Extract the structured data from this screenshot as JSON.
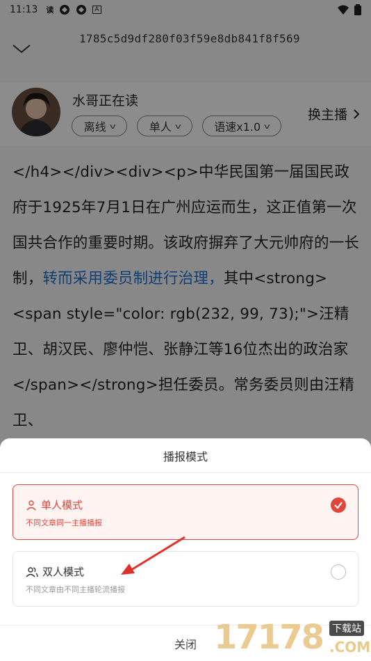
{
  "status": {
    "time": "11:13",
    "read_badge": "读",
    "notif_a": "A"
  },
  "header": {
    "article_id": "1785c5d9df280f03f59e8db841f8f569"
  },
  "reader": {
    "name": "水哥正在读",
    "mode_online": "离线",
    "mode_people": "单人",
    "speed": "语速x1.0",
    "switch_anchor": "换主播"
  },
  "content": {
    "part1": "</h4></div><div><p>中华民国第一届国民政府于1925年7月1日在广州应运而生，这正值第一次国共合作的重要时期。该政府摒弃了大元帅府的一长制，",
    "highlight": "转而采用委员制进行治理，",
    "part2": "其中<strong><span style=\"color: rgb(232, 99, 73);\">汪精卫、胡汉民、廖仲恺、张静江等16位杰出的政治家</span></strong>担任委员。常务委员则由汪精卫、"
  },
  "sheet": {
    "title": "播报模式",
    "options": [
      {
        "title": "单人模式",
        "desc": "不同文章同一主播播报",
        "selected": true
      },
      {
        "title": "双人模式",
        "desc": "不同文章由不同主播轮流播报",
        "selected": false
      }
    ],
    "close": "关闭"
  },
  "watermark": {
    "number": "17178",
    "suffix": ".COM",
    "badge": "下载站"
  },
  "colors": {
    "accent": "#e0473a",
    "link": "#1e6fd0"
  }
}
